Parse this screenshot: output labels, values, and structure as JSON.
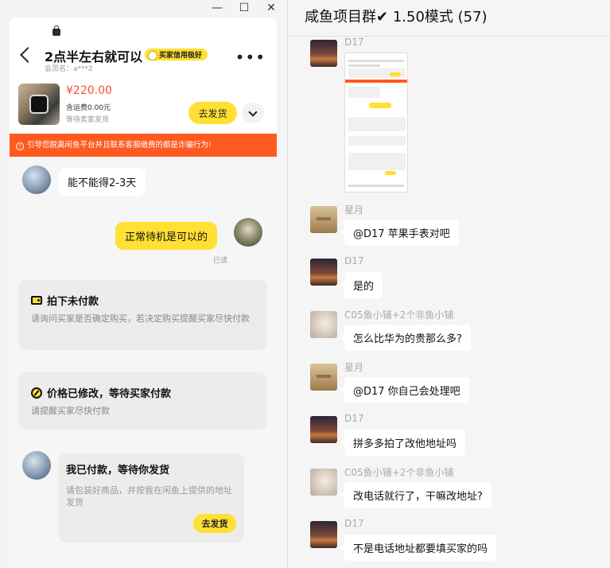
{
  "left_window": {
    "controls": {
      "minimize": "—",
      "maximize": "☐",
      "close": "✕"
    },
    "chat_title": "2点半左右就可以",
    "credit_badge": "买家信用极好",
    "member_name": "会员名：a***2",
    "product": {
      "price": "¥220.00",
      "shipping_fee": "含运费0.00元",
      "status": "等待卖家发货",
      "ship_button": "去发货"
    },
    "warning": "引导您脱离闲鱼平台并且联系客服缴费的都是诈骗行为!",
    "messages": [
      {
        "side": "in",
        "text": "能不能得2-3天"
      },
      {
        "side": "out",
        "text": "正常待机是可以的",
        "read": "已读"
      }
    ],
    "status_cards": [
      {
        "title": "拍下未付款",
        "desc": "请询问买家是否确定购买，若决定购买提醒买家尽快付款"
      },
      {
        "title": "价格已修改，等待买家付款",
        "desc": "请提醒买家尽快付款"
      }
    ],
    "paid_card": {
      "title": "我已付款，等待你发货",
      "desc": "请包装好商品，并按我在闲鱼上提供的地址发货",
      "button": "去发货"
    }
  },
  "right_window": {
    "group_title": "咸鱼项目群",
    "group_mode": "1.50模式 (57)",
    "messages": [
      {
        "sender": "D17",
        "type": "image",
        "avatar": "d17"
      },
      {
        "sender": "星月",
        "text": "@D17 苹果手表对吧",
        "avatar": "xingyue"
      },
      {
        "sender": "D17",
        "text": "是的",
        "avatar": "d17"
      },
      {
        "sender": "C05鱼小铺+2个非鱼小铺",
        "text": "怎么比华为的贵那么多?",
        "avatar": "c05"
      },
      {
        "sender": "星月",
        "text": "@D17  你自己会处理吧",
        "avatar": "xingyue"
      },
      {
        "sender": "D17",
        "text": "拼多多拍了改他地址吗",
        "avatar": "d17"
      },
      {
        "sender": "C05鱼小铺+2个非鱼小铺",
        "text": "改电话就行了，干嘛改地址?",
        "avatar": "c05"
      },
      {
        "sender": "D17",
        "text": "不是电话地址都要填买家的吗",
        "avatar": "d17"
      }
    ]
  },
  "colors": {
    "accent_yellow": "#ffe033",
    "warning_orange": "#ff5a1f",
    "price_red": "#ff4d2e"
  }
}
